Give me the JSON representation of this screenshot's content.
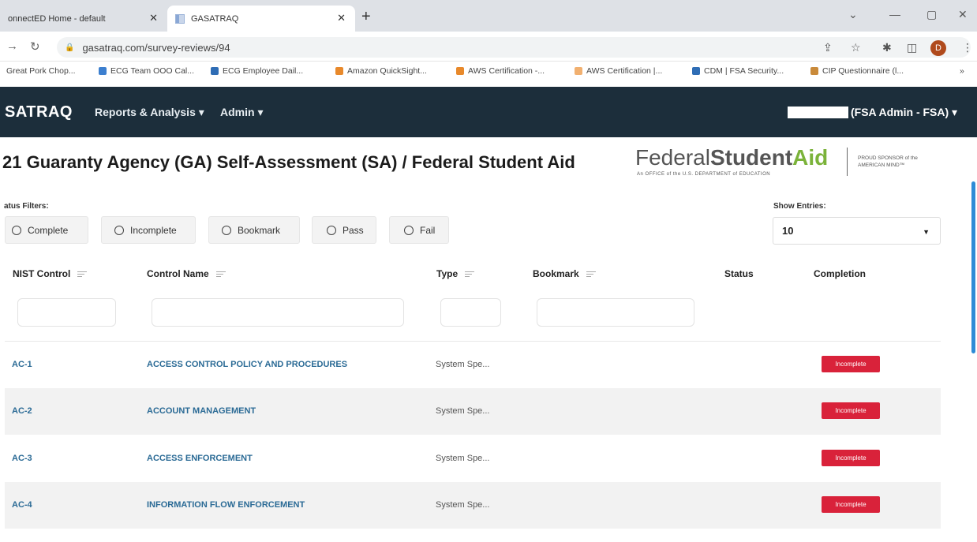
{
  "browser": {
    "tabs": [
      {
        "label": "onnectED Home - default"
      },
      {
        "label": "GASATRAQ"
      }
    ],
    "url": "gasatraq.com/survey-reviews/94",
    "profile_initial": "D",
    "bookmarks": [
      {
        "label": "Great Pork Chop...",
        "color": "#d9b28a"
      },
      {
        "label": "ECG Team OOO Cal...",
        "color": "#3c7fcf"
      },
      {
        "label": "ECG Employee Dail...",
        "color": "#2f6db5"
      },
      {
        "label": "Amazon QuickSight...",
        "color": "#e8892b"
      },
      {
        "label": "AWS Certification -...",
        "color": "#e8892b"
      },
      {
        "label": "AWS Certification |...",
        "color": "#f1b070"
      },
      {
        "label": "CDM | FSA Security...",
        "color": "#2f6db5"
      },
      {
        "label": "CIP Questionnaire (l...",
        "color": "#c98a3a"
      }
    ]
  },
  "navbar": {
    "brand": "SATRAQ",
    "menus": [
      {
        "label": "Reports & Analysis ▾"
      },
      {
        "label": "Admin ▾"
      }
    ],
    "user_role": "(FSA Admin - FSA) ▾"
  },
  "page": {
    "title": "21 Guaranty Agency (GA) Self-Assessment (SA) / Federal Student Aid"
  },
  "logo": {
    "federal": "Federal",
    "student": "Student",
    "aid": "Aid",
    "subline": "An OFFICE of the U.S. DEPARTMENT of EDUCATION",
    "sponsor": "PROUD SPONSOR of the AMERICAN MIND™"
  },
  "filters": {
    "label": "atus Filters:",
    "options": [
      {
        "label": "Complete"
      },
      {
        "label": "Incomplete"
      },
      {
        "label": "Bookmark"
      },
      {
        "label": "Pass"
      },
      {
        "label": "Fail"
      }
    ]
  },
  "entries": {
    "label": "Show Entries:",
    "value": "10"
  },
  "table": {
    "headers": {
      "nist": "NIST Control",
      "name": "Control Name",
      "type": "Type",
      "bookmark": "Bookmark",
      "status": "Status",
      "completion": "Completion"
    },
    "rows": [
      {
        "nist": "AC-1",
        "name": "ACCESS CONTROL POLICY AND PROCEDURES",
        "type": "System Spe...",
        "completion": "Incomplete"
      },
      {
        "nist": "AC-2",
        "name": "ACCOUNT MANAGEMENT",
        "type": "System Spe...",
        "completion": "Incomplete"
      },
      {
        "nist": "AC-3",
        "name": "ACCESS ENFORCEMENT",
        "type": "System Spe...",
        "completion": "Incomplete"
      },
      {
        "nist": "AC-4",
        "name": "INFORMATION FLOW ENFORCEMENT",
        "type": "System Spe...",
        "completion": "Incomplete"
      }
    ]
  },
  "colors": {
    "navbar_bg": "#1c2e3b",
    "link": "#2a6a95",
    "incomplete_badge": "#d9223a",
    "logo_aid": "#7bb33a"
  }
}
